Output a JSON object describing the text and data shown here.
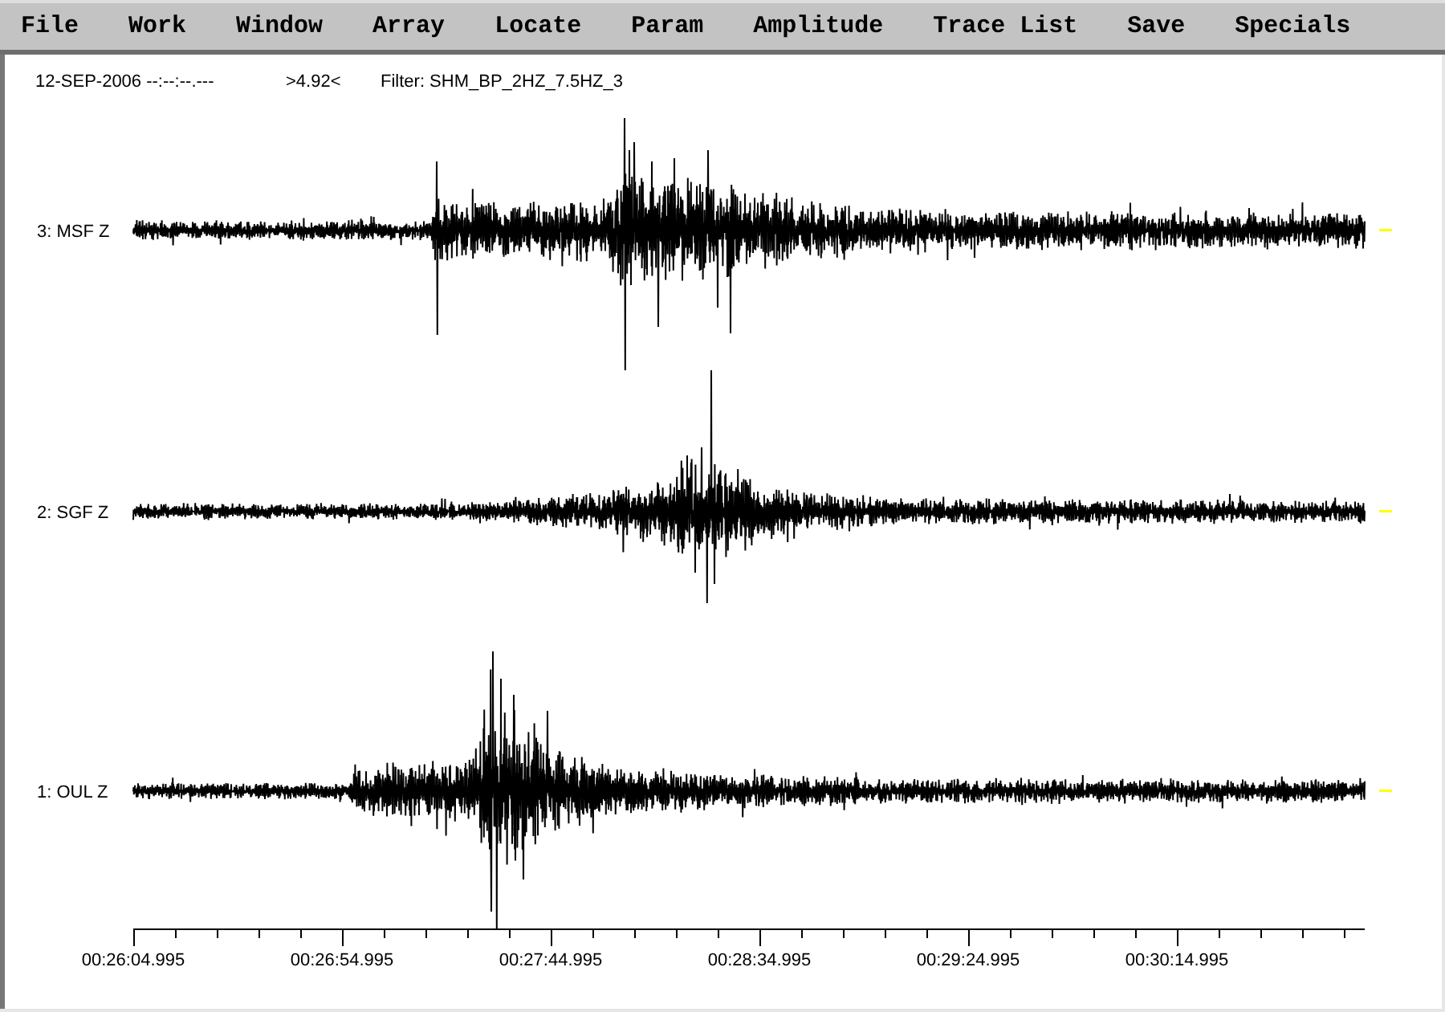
{
  "menu_bar": [
    "File",
    "Work",
    "Window",
    "Array",
    "Locate",
    "Param",
    "Amplitude",
    "Trace List",
    "Save",
    "Specials"
  ],
  "header": {
    "date_time": "12-SEP-2006 --:--:--.---",
    "scale": ">4.92<",
    "filter": "Filter: SHM_BP_2HZ_7.5HZ_3"
  },
  "traces": [
    {
      "label": "3: MSF Z"
    },
    {
      "label": "2: SGF Z"
    },
    {
      "label": "1: OUL Z"
    }
  ],
  "time_axis": {
    "tick_labels": [
      "00:26:04.995",
      "00:26:54.995",
      "00:27:44.995",
      "00:28:34.995",
      "00:29:24.995",
      "00:30:14.995"
    ]
  }
}
